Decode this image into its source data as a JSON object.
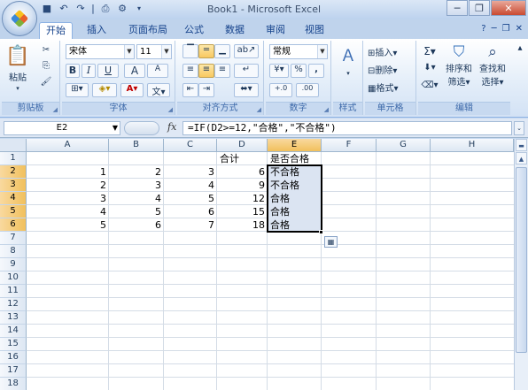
{
  "window": {
    "title": "Book1 - Microsoft Excel"
  },
  "qat": {
    "save_icon": "save-icon",
    "undo_icon": "undo-icon",
    "redo_icon": "redo-icon"
  },
  "tabs": [
    "开始",
    "插入",
    "页面布局",
    "公式",
    "数据",
    "审阅",
    "视图"
  ],
  "ribbon": {
    "clipboard": {
      "label": "剪贴板",
      "paste": "粘贴"
    },
    "font": {
      "label": "字体",
      "name": "宋体",
      "size": "11",
      "bold": "B",
      "italic": "I",
      "underline": "U",
      "grow": "A",
      "shrink": "A",
      "wen": "文"
    },
    "alignment": {
      "label": "对齐方式"
    },
    "number": {
      "label": "数字",
      "format": "常规",
      "percent": "%",
      "comma": ","
    },
    "styles": {
      "label": "样式"
    },
    "cells": {
      "label": "单元格",
      "insert": "插入",
      "delete": "删除",
      "format": "格式"
    },
    "editing": {
      "label": "编辑",
      "sort_filter_1": "排序和",
      "sort_filter_2": "筛选",
      "find_select_1": "查找和",
      "find_select_2": "选择"
    }
  },
  "formula_bar": {
    "name_box": "E2",
    "fx": "fx",
    "formula": "=IF(D2>=12,\"合格\",\"不合格\")"
  },
  "grid": {
    "columns": [
      "A",
      "B",
      "C",
      "D",
      "E",
      "F",
      "G",
      "H"
    ],
    "rows": [
      "1",
      "2",
      "3",
      "4",
      "5",
      "6",
      "7",
      "8",
      "9",
      "10",
      "11",
      "12",
      "13",
      "14",
      "15",
      "16",
      "17",
      "18"
    ],
    "headers": {
      "D1": "合计",
      "E1": "是否合格"
    },
    "data": [
      {
        "a": "1",
        "b": "2",
        "c": "3",
        "d": "6",
        "e": "不合格"
      },
      {
        "a": "2",
        "b": "3",
        "c": "4",
        "d": "9",
        "e": "不合格"
      },
      {
        "a": "3",
        "b": "4",
        "c": "5",
        "d": "12",
        "e": "合格"
      },
      {
        "a": "4",
        "b": "5",
        "c": "6",
        "d": "15",
        "e": "合格"
      },
      {
        "a": "5",
        "b": "6",
        "c": "7",
        "d": "18",
        "e": "合格"
      }
    ]
  },
  "colors": {
    "accent": "#15428b",
    "selection_header": "#f1c05c"
  }
}
